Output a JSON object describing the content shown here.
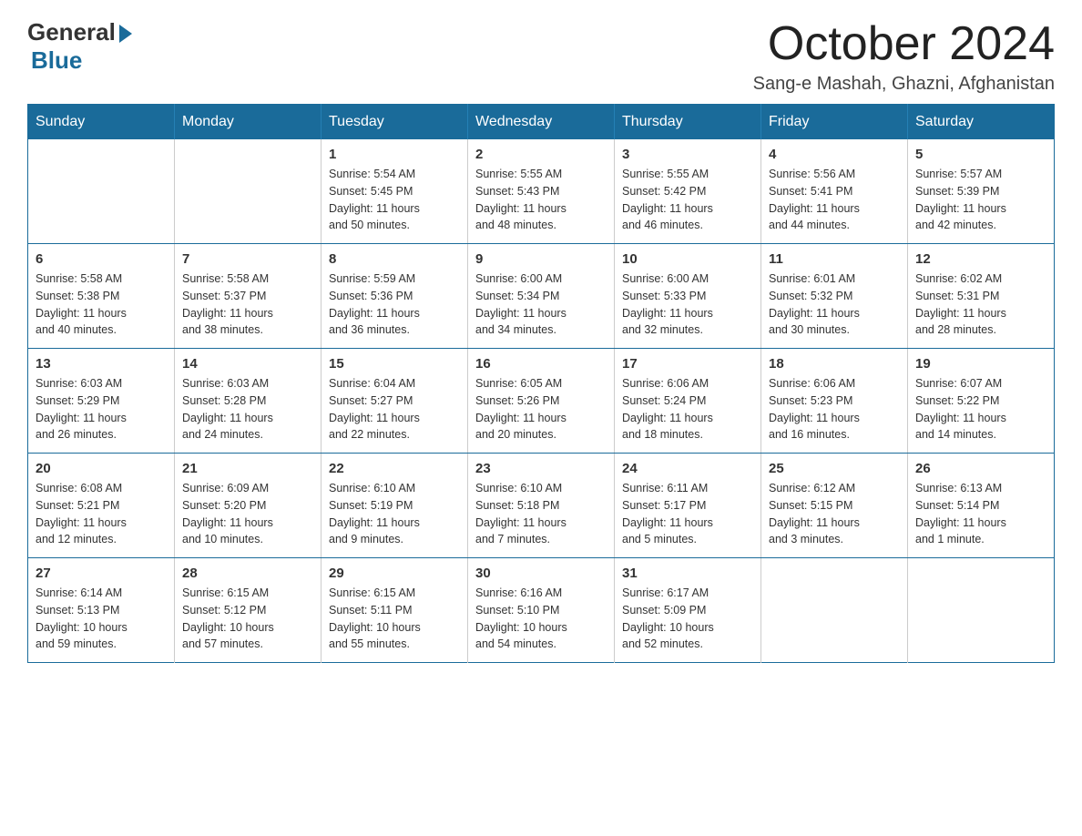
{
  "header": {
    "logo_general": "General",
    "logo_blue": "Blue",
    "month_title": "October 2024",
    "location": "Sang-e Mashah, Ghazni, Afghanistan"
  },
  "days_of_week": [
    "Sunday",
    "Monday",
    "Tuesday",
    "Wednesday",
    "Thursday",
    "Friday",
    "Saturday"
  ],
  "weeks": [
    [
      {
        "day": "",
        "info": ""
      },
      {
        "day": "",
        "info": ""
      },
      {
        "day": "1",
        "info": "Sunrise: 5:54 AM\nSunset: 5:45 PM\nDaylight: 11 hours\nand 50 minutes."
      },
      {
        "day": "2",
        "info": "Sunrise: 5:55 AM\nSunset: 5:43 PM\nDaylight: 11 hours\nand 48 minutes."
      },
      {
        "day": "3",
        "info": "Sunrise: 5:55 AM\nSunset: 5:42 PM\nDaylight: 11 hours\nand 46 minutes."
      },
      {
        "day": "4",
        "info": "Sunrise: 5:56 AM\nSunset: 5:41 PM\nDaylight: 11 hours\nand 44 minutes."
      },
      {
        "day": "5",
        "info": "Sunrise: 5:57 AM\nSunset: 5:39 PM\nDaylight: 11 hours\nand 42 minutes."
      }
    ],
    [
      {
        "day": "6",
        "info": "Sunrise: 5:58 AM\nSunset: 5:38 PM\nDaylight: 11 hours\nand 40 minutes."
      },
      {
        "day": "7",
        "info": "Sunrise: 5:58 AM\nSunset: 5:37 PM\nDaylight: 11 hours\nand 38 minutes."
      },
      {
        "day": "8",
        "info": "Sunrise: 5:59 AM\nSunset: 5:36 PM\nDaylight: 11 hours\nand 36 minutes."
      },
      {
        "day": "9",
        "info": "Sunrise: 6:00 AM\nSunset: 5:34 PM\nDaylight: 11 hours\nand 34 minutes."
      },
      {
        "day": "10",
        "info": "Sunrise: 6:00 AM\nSunset: 5:33 PM\nDaylight: 11 hours\nand 32 minutes."
      },
      {
        "day": "11",
        "info": "Sunrise: 6:01 AM\nSunset: 5:32 PM\nDaylight: 11 hours\nand 30 minutes."
      },
      {
        "day": "12",
        "info": "Sunrise: 6:02 AM\nSunset: 5:31 PM\nDaylight: 11 hours\nand 28 minutes."
      }
    ],
    [
      {
        "day": "13",
        "info": "Sunrise: 6:03 AM\nSunset: 5:29 PM\nDaylight: 11 hours\nand 26 minutes."
      },
      {
        "day": "14",
        "info": "Sunrise: 6:03 AM\nSunset: 5:28 PM\nDaylight: 11 hours\nand 24 minutes."
      },
      {
        "day": "15",
        "info": "Sunrise: 6:04 AM\nSunset: 5:27 PM\nDaylight: 11 hours\nand 22 minutes."
      },
      {
        "day": "16",
        "info": "Sunrise: 6:05 AM\nSunset: 5:26 PM\nDaylight: 11 hours\nand 20 minutes."
      },
      {
        "day": "17",
        "info": "Sunrise: 6:06 AM\nSunset: 5:24 PM\nDaylight: 11 hours\nand 18 minutes."
      },
      {
        "day": "18",
        "info": "Sunrise: 6:06 AM\nSunset: 5:23 PM\nDaylight: 11 hours\nand 16 minutes."
      },
      {
        "day": "19",
        "info": "Sunrise: 6:07 AM\nSunset: 5:22 PM\nDaylight: 11 hours\nand 14 minutes."
      }
    ],
    [
      {
        "day": "20",
        "info": "Sunrise: 6:08 AM\nSunset: 5:21 PM\nDaylight: 11 hours\nand 12 minutes."
      },
      {
        "day": "21",
        "info": "Sunrise: 6:09 AM\nSunset: 5:20 PM\nDaylight: 11 hours\nand 10 minutes."
      },
      {
        "day": "22",
        "info": "Sunrise: 6:10 AM\nSunset: 5:19 PM\nDaylight: 11 hours\nand 9 minutes."
      },
      {
        "day": "23",
        "info": "Sunrise: 6:10 AM\nSunset: 5:18 PM\nDaylight: 11 hours\nand 7 minutes."
      },
      {
        "day": "24",
        "info": "Sunrise: 6:11 AM\nSunset: 5:17 PM\nDaylight: 11 hours\nand 5 minutes."
      },
      {
        "day": "25",
        "info": "Sunrise: 6:12 AM\nSunset: 5:15 PM\nDaylight: 11 hours\nand 3 minutes."
      },
      {
        "day": "26",
        "info": "Sunrise: 6:13 AM\nSunset: 5:14 PM\nDaylight: 11 hours\nand 1 minute."
      }
    ],
    [
      {
        "day": "27",
        "info": "Sunrise: 6:14 AM\nSunset: 5:13 PM\nDaylight: 10 hours\nand 59 minutes."
      },
      {
        "day": "28",
        "info": "Sunrise: 6:15 AM\nSunset: 5:12 PM\nDaylight: 10 hours\nand 57 minutes."
      },
      {
        "day": "29",
        "info": "Sunrise: 6:15 AM\nSunset: 5:11 PM\nDaylight: 10 hours\nand 55 minutes."
      },
      {
        "day": "30",
        "info": "Sunrise: 6:16 AM\nSunset: 5:10 PM\nDaylight: 10 hours\nand 54 minutes."
      },
      {
        "day": "31",
        "info": "Sunrise: 6:17 AM\nSunset: 5:09 PM\nDaylight: 10 hours\nand 52 minutes."
      },
      {
        "day": "",
        "info": ""
      },
      {
        "day": "",
        "info": ""
      }
    ]
  ]
}
